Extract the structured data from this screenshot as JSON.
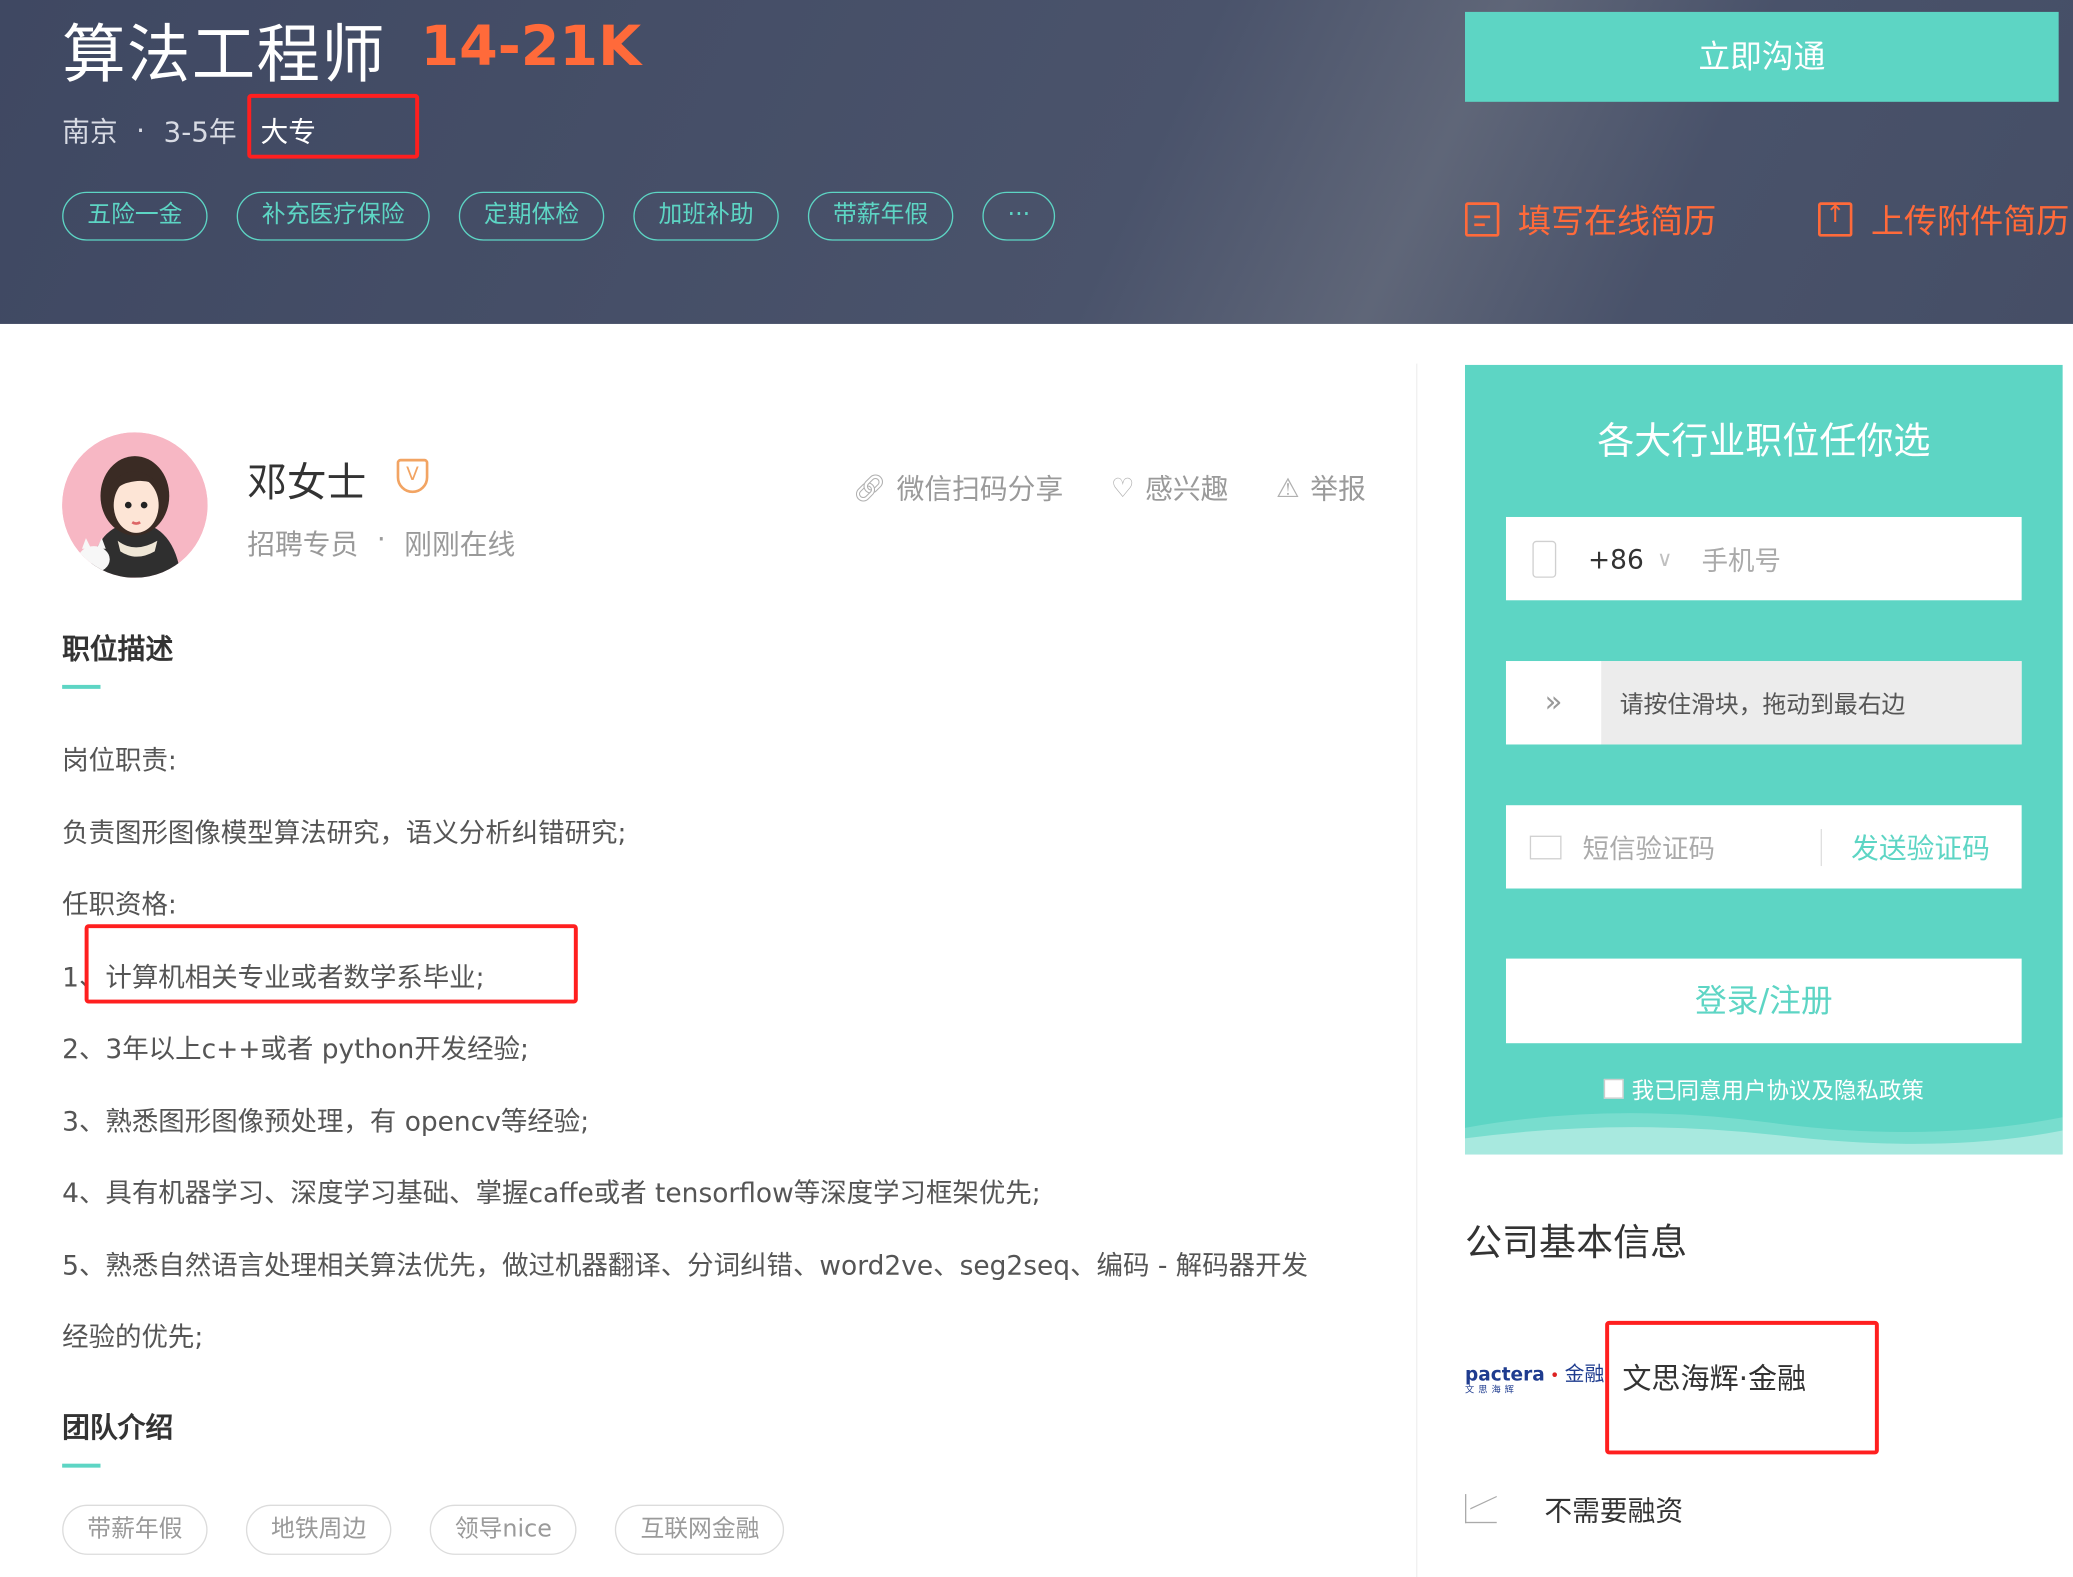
{
  "header": {
    "job_title": "算法工程师",
    "salary": "14-21K",
    "city": "南京",
    "experience": "3-5年",
    "education": "大专",
    "welfare_tags": [
      "五险一金",
      "补充医疗保险",
      "定期体检",
      "加班补助",
      "带薪年假",
      "···"
    ],
    "chat_button": "立即沟通",
    "fill_resume": "填写在线简历",
    "upload_resume": "上传附件简历"
  },
  "recruiter": {
    "name": "邓女士",
    "badge": "V",
    "title": "招聘专员",
    "sep": "·",
    "status": "刚刚在线",
    "share": "微信扫码分享",
    "interest": "感兴趣",
    "report": "举报"
  },
  "job_description": {
    "heading": "职位描述",
    "lines": [
      "岗位职责:",
      "负责图形图像模型算法研究，语义分析纠错研究;",
      "任职资格:",
      "1、计算机相关专业或者数学系毕业;",
      "2、3年以上c++或者 python开发经验;",
      "3、熟悉图形图像预处理，有 opencv等经验;",
      "4、具有机器学习、深度学习基础、掌握caffe或者 tensorflow等深度学习框架优先;",
      "5、熟悉自然语言处理相关算法优先，做过机器翻译、分词纠错、word2ve、seg2seq、编码 - 解码器开发",
      "经验的优先;"
    ]
  },
  "team": {
    "heading": "团队介绍",
    "tags": [
      "带薪年假",
      "地铁周边",
      "领导nice",
      "互联网金融"
    ]
  },
  "login_panel": {
    "title": "各大行业职位任你选",
    "country_code": "+86",
    "phone_placeholder": "手机号",
    "slider_hint": "请按住滑块，拖动到最右边",
    "sms_placeholder": "短信验证码",
    "send_code": "发送验证码",
    "login_button": "登录/注册",
    "agreement": "我已同意用户协议及隐私政策"
  },
  "company": {
    "heading": "公司基本信息",
    "logo_text": "pactera",
    "logo_sub": "文思海辉",
    "logo_suffix": "金融",
    "name": "文思海辉·金融",
    "financing": "不需要融资"
  }
}
